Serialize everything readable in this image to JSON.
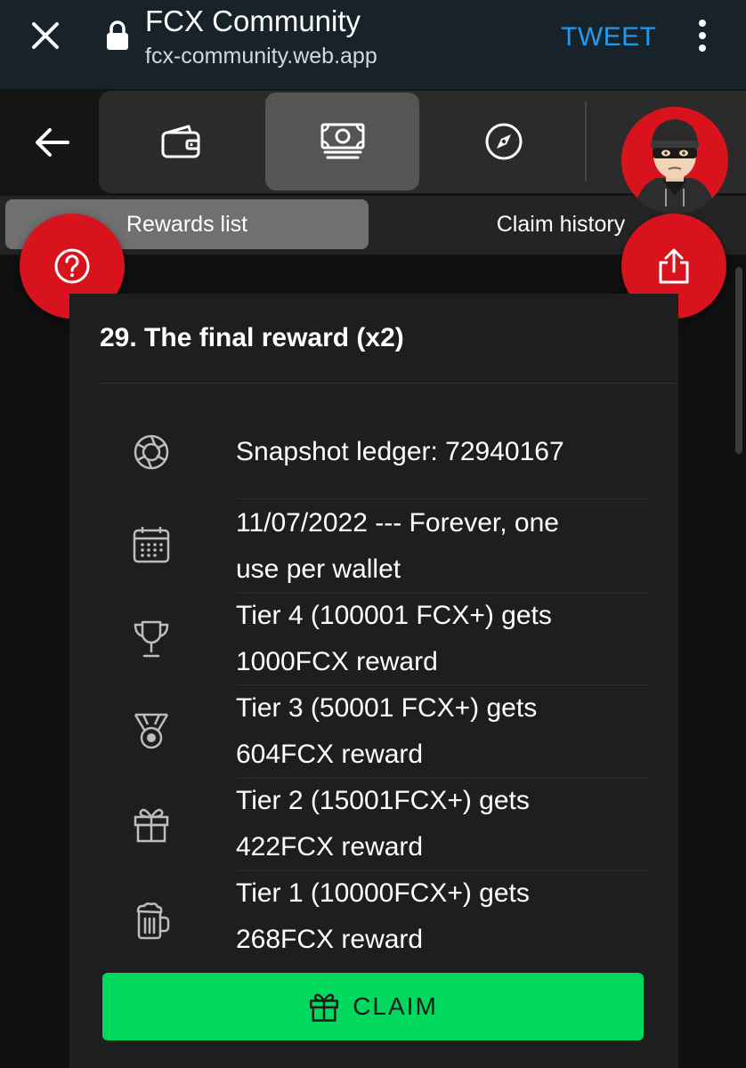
{
  "browser": {
    "title": "FCX Community",
    "url": "fcx-community.web.app",
    "tweet_label": "TWEET"
  },
  "nav": {
    "items": [
      {
        "icon": "wallet-icon",
        "active": false
      },
      {
        "icon": "cash-icon",
        "active": true
      },
      {
        "icon": "compass-icon",
        "active": false
      }
    ]
  },
  "tabs": {
    "rewards_list": "Rewards list",
    "claim_history": "Claim history"
  },
  "reward": {
    "title": "29. The final reward (x2)",
    "rows": [
      {
        "icon": "aperture-icon",
        "line1": "Snapshot ledger: 72940167",
        "line2": ""
      },
      {
        "icon": "calendar-icon",
        "line1": "11/07/2022 --- Forever, one",
        "line2": "use per wallet"
      },
      {
        "icon": "trophy-icon",
        "line1": "Tier 4 (100001 FCX+) gets",
        "line2": "1000FCX reward"
      },
      {
        "icon": "medal-icon",
        "line1": "Tier 3 (50001 FCX+) gets",
        "line2": "604FCX reward"
      },
      {
        "icon": "gift-icon",
        "line1": "Tier 2 (15001FCX+) gets",
        "line2": "422FCX reward"
      },
      {
        "icon": "beer-mug-icon",
        "line1": "Tier 1 (10000FCX+) gets",
        "line2": "268FCX reward"
      }
    ],
    "claim_label": "CLAIM"
  },
  "colors": {
    "accent_red": "#d8131d",
    "claim_green": "#00d95d",
    "tweet_blue": "#1d9bf0"
  }
}
